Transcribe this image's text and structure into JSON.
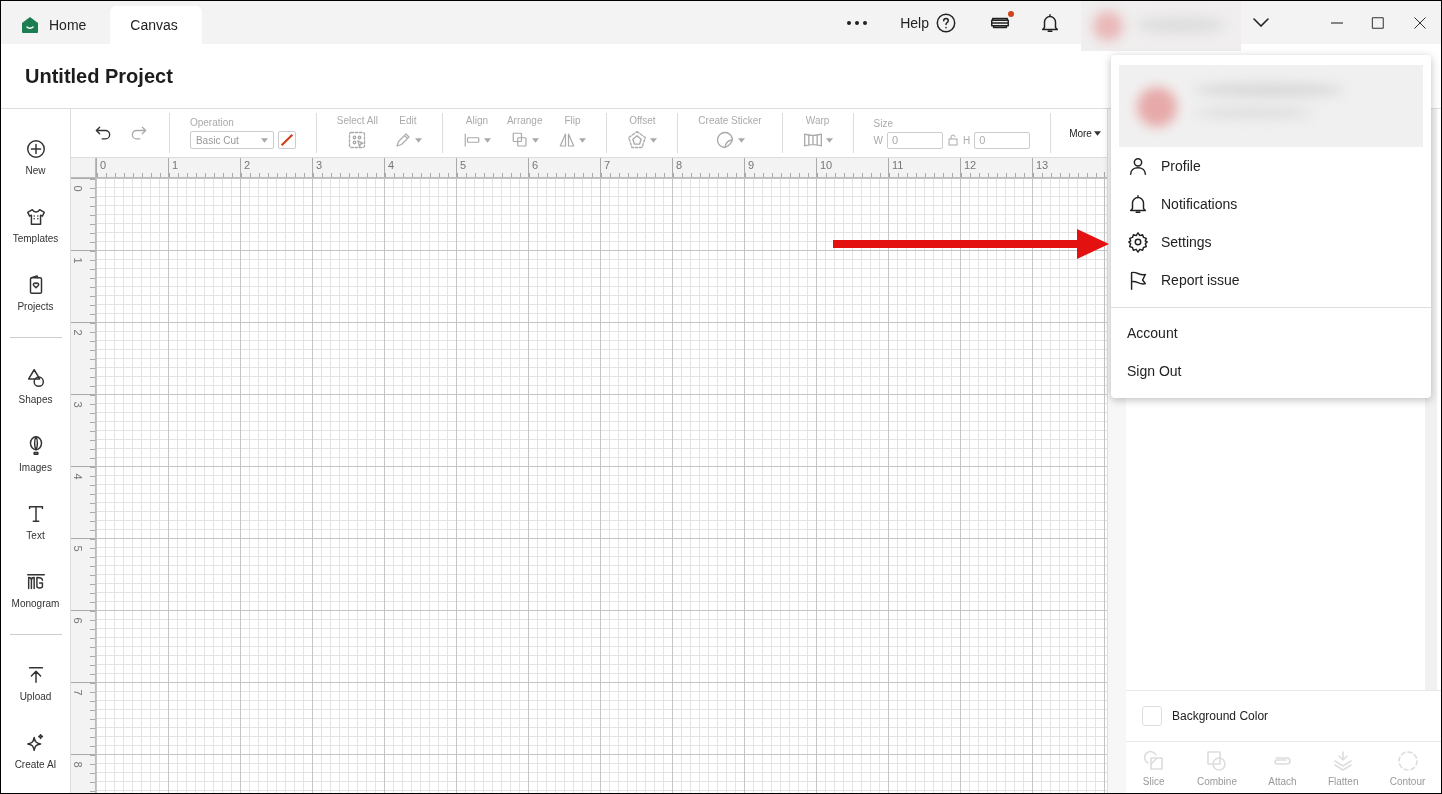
{
  "tabs": [
    {
      "label": "Home",
      "kind": "home",
      "selected": false
    },
    {
      "label": "Canvas",
      "kind": "plain",
      "selected": true
    }
  ],
  "top_bar": {
    "help": "Help",
    "notification_dot": true
  },
  "project_title": "Untitled Project",
  "sidebar": {
    "groups": [
      [
        {
          "label": "New"
        },
        {
          "label": "Templates"
        },
        {
          "label": "Projects"
        }
      ],
      [
        {
          "label": "Shapes"
        },
        {
          "label": "Images"
        },
        {
          "label": "Text"
        },
        {
          "label": "Monogram"
        }
      ],
      [
        {
          "label": "Upload"
        },
        {
          "label": "Create AI"
        }
      ]
    ]
  },
  "toolbar": {
    "undo": {
      "disabled": false
    },
    "redo": {
      "disabled": true
    },
    "operation": {
      "label": "Operation",
      "value": "Basic Cut",
      "disabled": true
    },
    "tools": [
      {
        "label": "Select All",
        "kind": "select",
        "disabled": true
      },
      {
        "label": "Edit",
        "kind": "edit",
        "disabled": true
      },
      {
        "label": "Align",
        "kind": "align",
        "disabled": true
      },
      {
        "label": "Arrange",
        "kind": "arrange",
        "disabled": true
      },
      {
        "label": "Flip",
        "kind": "flip",
        "disabled": true
      },
      {
        "label": "Offset",
        "kind": "offset",
        "disabled": true
      },
      {
        "label": "Create Sticker",
        "kind": "sticker",
        "disabled": true
      },
      {
        "label": "Warp",
        "kind": "warp",
        "disabled": true
      }
    ],
    "size": {
      "label": "Size",
      "w_label": "W",
      "w_value": "0",
      "h_label": "H",
      "h_value": "0",
      "disabled": true
    },
    "more": "More"
  },
  "ruler": {
    "x_labels": [
      "0",
      "1",
      "2",
      "3",
      "4",
      "5",
      "6",
      "7",
      "8",
      "9",
      "10",
      "11",
      "12",
      "13"
    ],
    "y_labels": [
      "0",
      "1",
      "2",
      "3",
      "4",
      "5",
      "6",
      "7",
      "8"
    ]
  },
  "account_menu": {
    "sections": [
      [
        {
          "label": "Profile",
          "kind": "profile"
        },
        {
          "label": "Notifications",
          "kind": "bell"
        },
        {
          "label": "Settings",
          "kind": "gear"
        },
        {
          "label": "Report issue",
          "kind": "flag"
        }
      ],
      [
        {
          "label": "Account",
          "kind": "plain"
        },
        {
          "label": "Sign Out",
          "kind": "plain"
        }
      ]
    ]
  },
  "right_panel": {
    "background_color": {
      "label": "Background Color",
      "checked": false
    },
    "bottom_tools": [
      {
        "label": "Slice",
        "kind": "slice",
        "disabled": true
      },
      {
        "label": "Combine",
        "kind": "combine",
        "disabled": true
      },
      {
        "label": "Attach",
        "kind": "attach",
        "disabled": true
      },
      {
        "label": "Flatten",
        "kind": "flatten",
        "disabled": true
      },
      {
        "label": "Contour",
        "kind": "contour",
        "disabled": true
      }
    ]
  }
}
